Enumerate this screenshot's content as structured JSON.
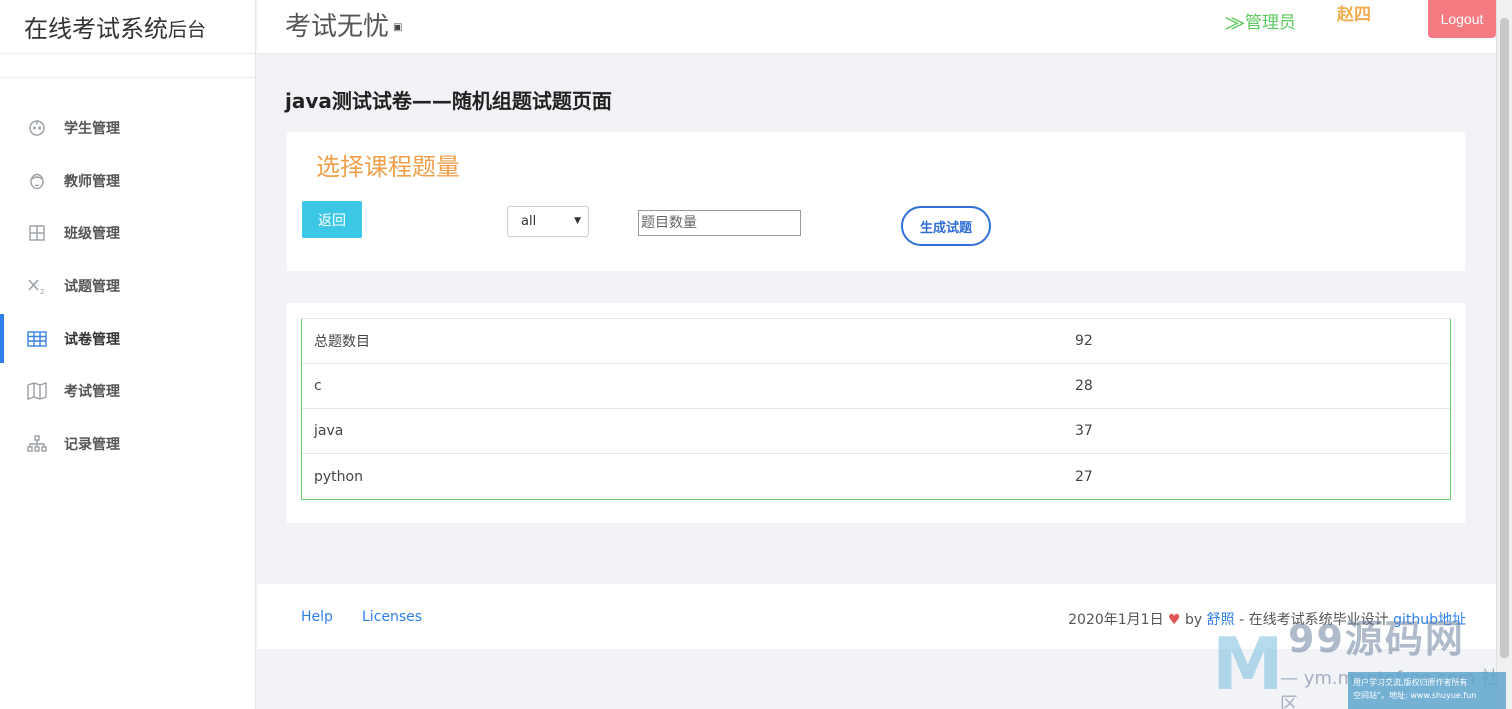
{
  "brand": {
    "main": "在线考试系统",
    "sub": "后台"
  },
  "header": {
    "app_title": "考试无忧",
    "title_suffix": "▣",
    "role": "⨠管理员",
    "username": "赵四",
    "logout": "Logout"
  },
  "sidebar": {
    "items": [
      {
        "label": "学生管理",
        "icon": "child-face-icon"
      },
      {
        "label": "教师管理",
        "icon": "face-icon"
      },
      {
        "label": "班级管理",
        "icon": "grid-icon"
      },
      {
        "label": "试题管理",
        "icon": "subscript-icon"
      },
      {
        "label": "试卷管理",
        "icon": "table-icon",
        "active": true
      },
      {
        "label": "考试管理",
        "icon": "map-icon"
      },
      {
        "label": "记录管理",
        "icon": "sitemap-icon"
      }
    ]
  },
  "page": {
    "heading": "java测试试卷——随机组题试题页面"
  },
  "form": {
    "title": "选择课程题量",
    "back_label": "返回",
    "select_value": "all",
    "qty_placeholder": "题目数量",
    "generate_label": "生成试题"
  },
  "table": {
    "rows": [
      {
        "name": "总题数目",
        "count": "92"
      },
      {
        "name": "c",
        "count": "28"
      },
      {
        "name": "java",
        "count": "37"
      },
      {
        "name": "python",
        "count": "27"
      }
    ]
  },
  "footer": {
    "help": "Help",
    "licenses": "Licenses",
    "date": "2020年1月1日",
    "heart": "♥",
    "by": "by",
    "author": "舒照",
    "desc": "- 在线考试系统毕业设计",
    "github": "github地址"
  },
  "watermark": {
    "logo": "M",
    "brand": "99源码网",
    "url": "— ym.mantofree.com 社区",
    "note_line1": "用户学习交流,版权归原作者所有",
    "note_line2": "空间站”。地址: www.shuyue.fun"
  },
  "colors": {
    "accent": "#2f80ed",
    "orange": "#f0a04b",
    "green": "#5cc85c",
    "logout": "#f47b82",
    "cyan": "#3cc7e6"
  }
}
